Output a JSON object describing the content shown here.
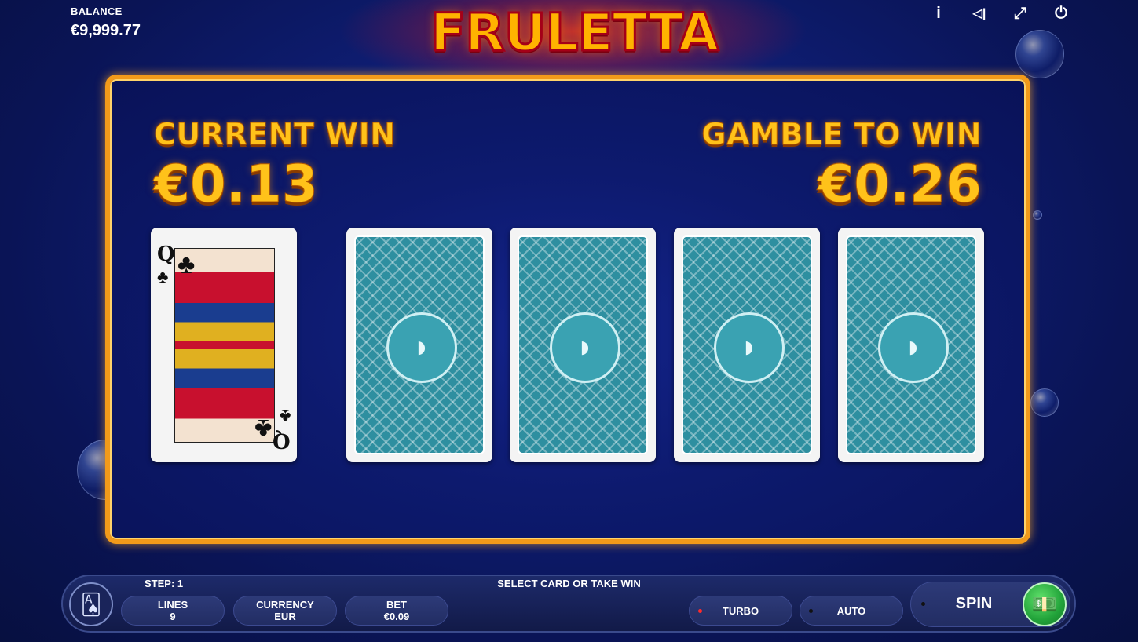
{
  "header": {
    "balance_label": "BALANCE",
    "balance_value": "€9,999.77",
    "logo_text": "FRULETTA",
    "icons": [
      "info-icon",
      "sound-icon",
      "fullscreen-icon",
      "power-icon"
    ],
    "icon_glyphs": {
      "info": "i",
      "sound": "◁|",
      "fullscreen": "⤢",
      "power": "⏻"
    }
  },
  "gamble": {
    "current_win_label": "CURRENT WIN",
    "current_win_value": "€0.13",
    "gamble_to_win_label": "GAMBLE TO WIN",
    "gamble_to_win_value": "€0.26",
    "dealer_card": {
      "rank": "Q",
      "suit": "♣"
    },
    "face_down_cards": 4,
    "card_emblem_glyph": "◗"
  },
  "footer": {
    "step_label": "STEP: 1",
    "status_text": "SELECT CARD OR TAKE WIN",
    "lines_label": "LINES",
    "lines_value": "9",
    "currency_label": "CURRENCY",
    "currency_value": "EUR",
    "bet_label": "BET",
    "bet_value": "€0.09",
    "turbo_label": "TURBO",
    "auto_label": "AUTO",
    "spin_label": "SPIN",
    "cards_glyph": "🂡",
    "collect_glyph": "💵"
  },
  "colors": {
    "accent_gold": "#ffc21a",
    "panel_border": "#f29a1a",
    "turbo_dot": "#ff2a2a",
    "card_back": "#2e8fa0",
    "spin_collect": "#22a33a"
  }
}
